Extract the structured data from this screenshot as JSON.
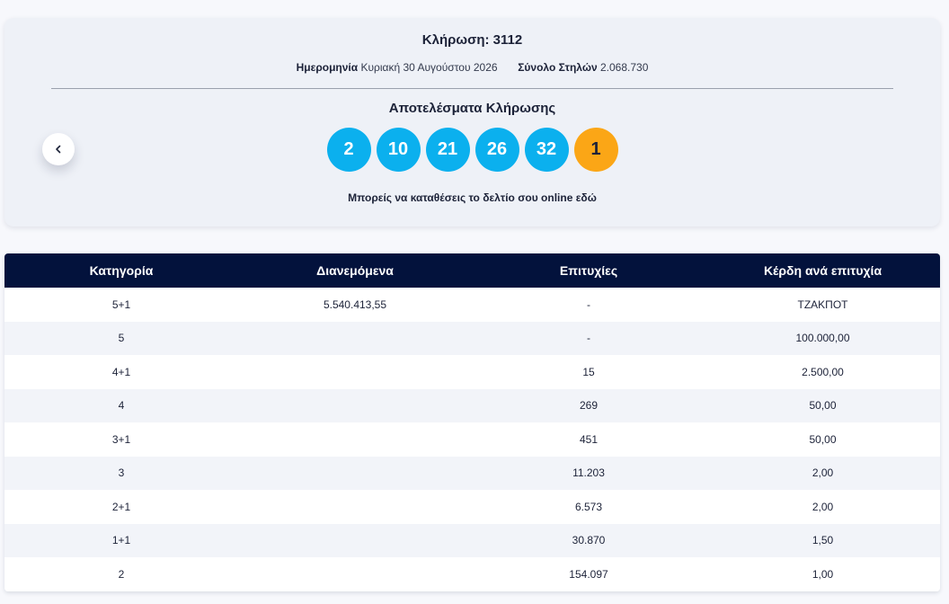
{
  "draw": {
    "title": "Κλήρωση: 3112",
    "date_label": "Ημερομηνία",
    "date_value": "Κυριακή 30 Αυγούστου 2026",
    "columns_label": "Σύνολο Στηλών",
    "columns_value": "2.068.730",
    "results_title": "Αποτελέσματα Κλήρωσης",
    "numbers": [
      "2",
      "10",
      "21",
      "26",
      "32"
    ],
    "bonus": "1",
    "online_text": "Μπορείς να καταθέσεις το δελτίο σου online εδώ"
  },
  "colors": {
    "ball_main": "#0bb0ee",
    "ball_bonus": "#fba616",
    "table_header": "#03123c"
  },
  "table": {
    "headers": [
      "Κατηγορία",
      "Διανεμόμενα",
      "Επιτυχίες",
      "Κέρδη ανά επιτυχία"
    ],
    "rows": [
      [
        "5+1",
        "5.540.413,55",
        "-",
        "ΤΖΑΚΠΟΤ"
      ],
      [
        "5",
        "",
        "-",
        "100.000,00"
      ],
      [
        "4+1",
        "",
        "15",
        "2.500,00"
      ],
      [
        "4",
        "",
        "269",
        "50,00"
      ],
      [
        "3+1",
        "",
        "451",
        "50,00"
      ],
      [
        "3",
        "",
        "11.203",
        "2,00"
      ],
      [
        "2+1",
        "",
        "6.573",
        "2,00"
      ],
      [
        "1+1",
        "",
        "30.870",
        "1,50"
      ],
      [
        "2",
        "",
        "154.097",
        "1,00"
      ]
    ]
  }
}
